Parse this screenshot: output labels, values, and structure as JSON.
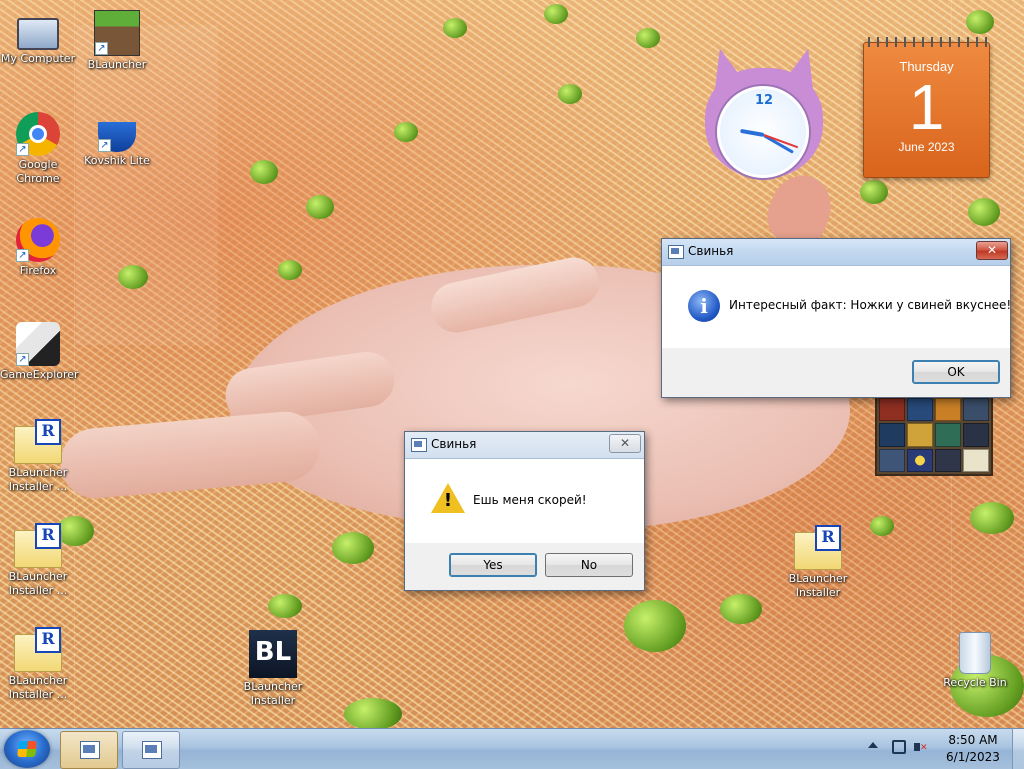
{
  "desktop": {
    "icons": [
      {
        "label": "My Computer"
      },
      {
        "label": "Google Chrome"
      },
      {
        "label": "Firefox"
      },
      {
        "label": "GameExplorer"
      },
      {
        "label": "BLauncher Installer ..."
      },
      {
        "label": "BLauncher Installer ..."
      },
      {
        "label": "BLauncher Installer ..."
      },
      {
        "label": "BLauncher"
      },
      {
        "label": "Kovshik Lite"
      },
      {
        "label": "BLauncher Installer"
      },
      {
        "label": "BLauncher Installer"
      },
      {
        "label": "Recycle Bin"
      }
    ]
  },
  "gadgets": {
    "clock": {
      "numeral": "12"
    },
    "calendar": {
      "weekday": "Thursday",
      "day": "1",
      "month_year": "June 2023"
    }
  },
  "dialog_info": {
    "title": "Свинья",
    "message": "Интересный факт: Ножки у свиней вкуснее!",
    "icon": "information-icon",
    "ok_label": "OK",
    "close_glyph": "✕"
  },
  "dialog_question": {
    "title": "Свинья",
    "message": "Ешь меня скорей!",
    "icon": "warning-icon",
    "yes_label": "Yes",
    "no_label": "No",
    "close_glyph": "✕"
  },
  "taskbar": {
    "time": "8:50 AM",
    "date": "6/1/2023",
    "items": [
      "app-window",
      "app-window"
    ]
  },
  "colors": {
    "taskbar": "#a9c4e0",
    "close_button": "#c03a24",
    "calendar": "#e27330",
    "titlebar": "#c2d8ef"
  }
}
